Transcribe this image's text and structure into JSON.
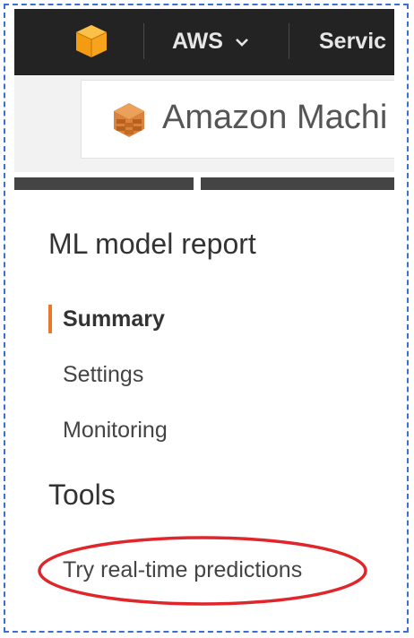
{
  "topbar": {
    "brand_menu_label": "AWS",
    "services_label": "Servic"
  },
  "service": {
    "title": "Amazon Machi"
  },
  "sidebar": {
    "heading": "ML model report",
    "items": [
      {
        "label": "Summary",
        "active": true
      },
      {
        "label": "Settings",
        "active": false
      },
      {
        "label": "Monitoring",
        "active": false
      }
    ],
    "tools_heading": "Tools",
    "tools_link": "Try real-time predictions"
  },
  "colors": {
    "accent_active": "#e8782a",
    "annotation_circle": "#e0262b",
    "frame_border": "#3b6fd6",
    "topbar_bg": "#232323",
    "aws_logo": "#f7a31c"
  },
  "icons": {
    "aws_logo": "aws-cube-icon",
    "service_icon": "machine-learning-icon",
    "dropdown": "chevron-down-icon"
  }
}
